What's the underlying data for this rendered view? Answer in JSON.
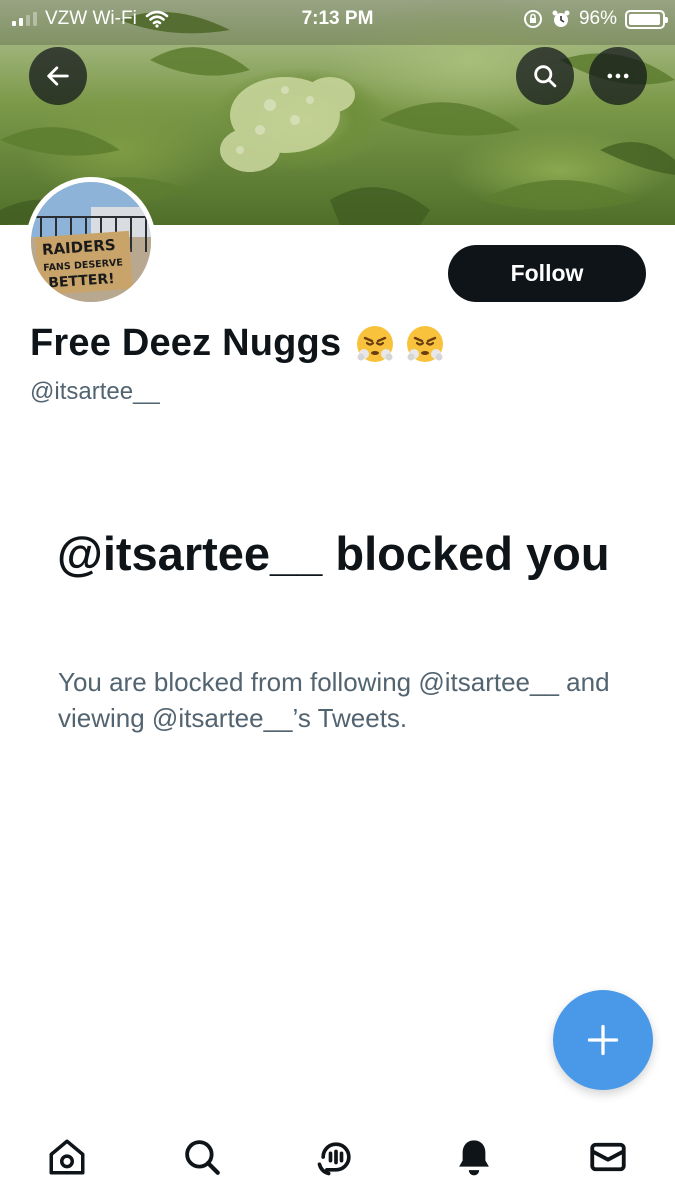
{
  "status_bar": {
    "carrier": "VZW Wi-Fi",
    "time": "7:13 PM",
    "battery_percent": "96%",
    "battery_level": 0.96,
    "icons": [
      "signal-bars-icon",
      "wifi-icon",
      "orientation-lock-icon",
      "alarm-icon",
      "battery-icon"
    ]
  },
  "header": {
    "back_icon": "arrow-left-icon",
    "search_icon": "search-icon",
    "more_icon": "more-horizontal-icon"
  },
  "profile": {
    "avatar_sign_text": [
      "RAIDERS",
      "FANS DESERVE",
      "BETTER!"
    ],
    "display_name": "Free Deez Nuggs",
    "name_emojis": [
      "face-with-steam-emoji",
      "face-with-steam-emoji"
    ],
    "handle": "@itsartee__",
    "follow_label": "Follow"
  },
  "blocked_notice": {
    "title": "@itsartee__ blocked you",
    "description": "You are blocked from following @itsartee__ and viewing @itsartee__’s Tweets."
  },
  "fab": {
    "icon": "plus-icon"
  },
  "bottom_nav": {
    "items": [
      "home-icon",
      "search-icon",
      "spaces-icon",
      "notifications-bell-icon",
      "messages-envelope-icon"
    ],
    "active": "notifications-bell-icon"
  },
  "colors": {
    "accent": "#4a99e9",
    "primary_text": "#0f1419",
    "secondary_text": "#536471",
    "follow_button": "#0f1419"
  }
}
